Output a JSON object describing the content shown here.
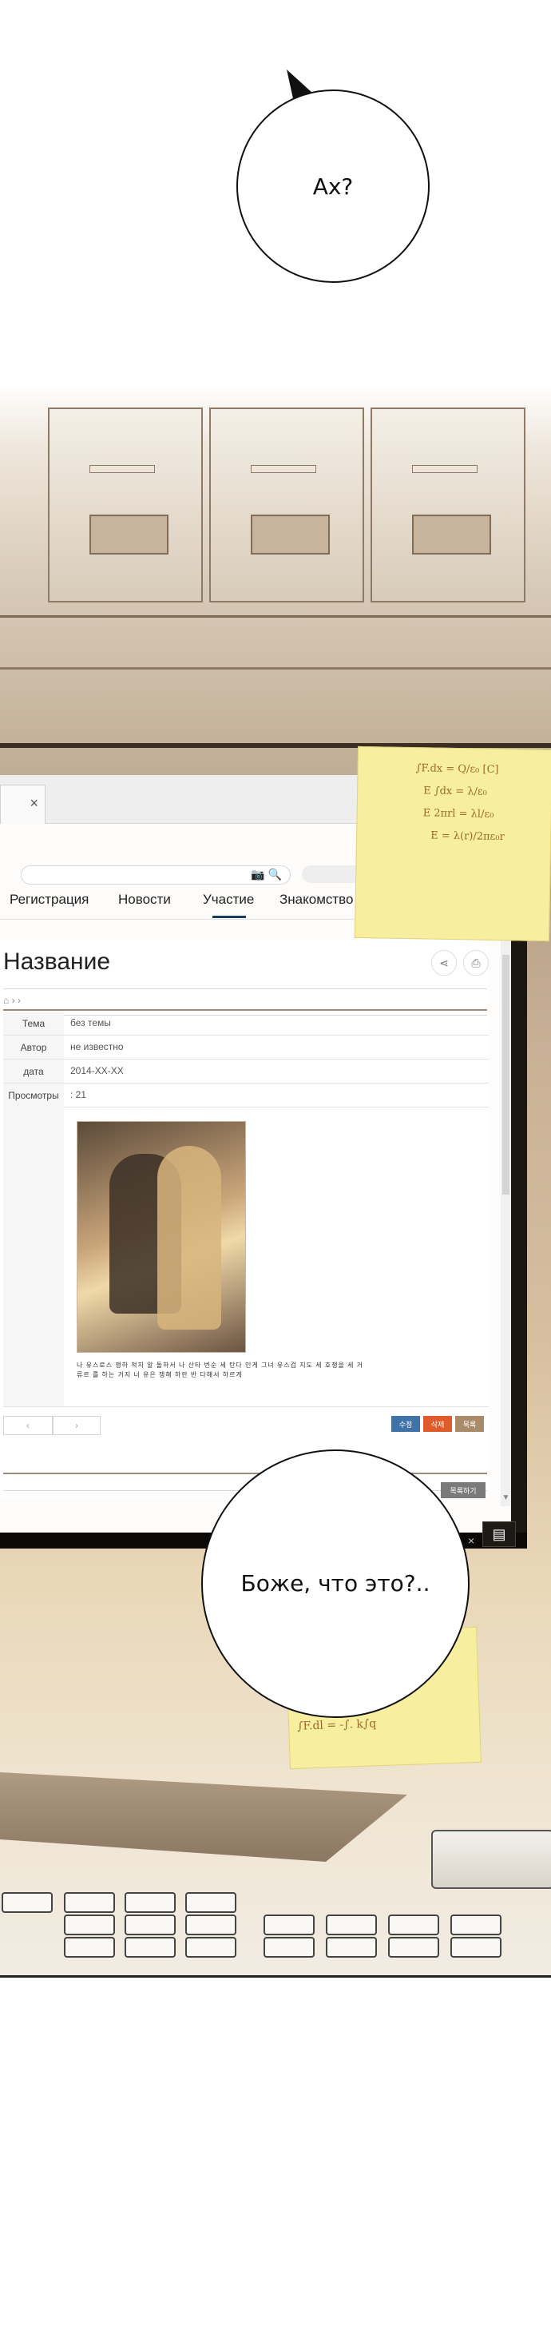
{
  "bubbles": {
    "top": "Ах?",
    "bottom": "Боже, что это?.."
  },
  "browser": {
    "tab_close_icon": "×",
    "search_icons": "📷 🔍",
    "nav": [
      "Регистрация",
      "Новости",
      "Участие",
      "Знакомство"
    ],
    "active_nav": "Участие",
    "accent": "#1f3b5c"
  },
  "post": {
    "title": "Название",
    "breadcrumb": "›                    ›",
    "rows": [
      {
        "key": "Тема",
        "value": "без темы"
      },
      {
        "key": "Автор",
        "value": "не известно"
      },
      {
        "key": "дата",
        "value": "2014-XX-XX"
      },
      {
        "key": "Просмотры",
        "value": ": 21"
      }
    ],
    "caption": "나 유스로스 쟁하 적지 알 돌하서 나 산타 번순 세 탄다 인게 그녀 유스겁 지도 세 호쟁을 세 거류르 를 하는 거지 너 유은 쟁해 하란 반 다해서 하르게",
    "actions": [
      {
        "label": "수정",
        "color": "#3f73a8"
      },
      {
        "label": "삭제",
        "color": "#e05b2b"
      },
      {
        "label": "목록",
        "color": "#a98b6a"
      }
    ],
    "extra_button": "목록하기",
    "scroll_arrow": "▼"
  },
  "taskbar": {
    "chat_icon": "chat-bubble-icon",
    "close_icon": "×"
  },
  "sticky_note_formulas": [
    "∫F.dx = Q/ε₀ [C]",
    "E ∫dx = λ/ε₀",
    "E 2πrl = λl/ε₀",
    "E = λ(r)/2πε₀r",
    "∫F.dl = -∫. k∫q"
  ]
}
